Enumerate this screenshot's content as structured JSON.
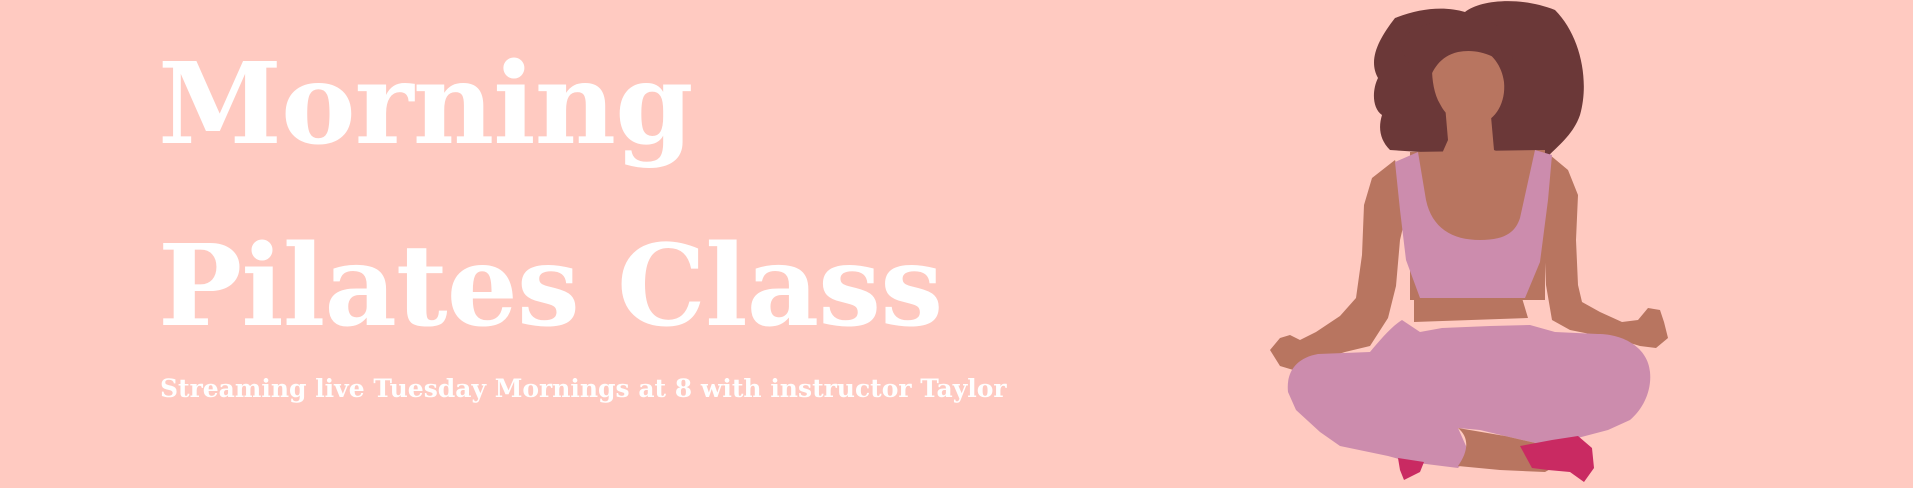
{
  "banner": {
    "title_line1": "Morning",
    "title_line2": "Pilates Class",
    "subtitle": "Streaming live Tuesday Mornings at 8 with instructor Taylor",
    "illustration": "meditating-woman-illustration"
  },
  "colors": {
    "background": "#ffcac1",
    "text": "#ffffff",
    "hair": "#6b3838",
    "skin": "#b87560",
    "outfit": "#cc8cad",
    "shoes": "#c92a62"
  }
}
